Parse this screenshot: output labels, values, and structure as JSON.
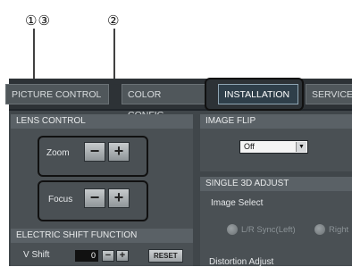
{
  "callouts": {
    "left": "①③",
    "right": "②"
  },
  "tabs": [
    "PICTURE CONTROL",
    "COLOR CONFIG",
    "INSTALLATION",
    "SERVICE"
  ],
  "lens_control": {
    "title": "LENS CONTROL",
    "zoom_label": "Zoom",
    "focus_label": "Focus",
    "minus": "−",
    "plus": "+"
  },
  "electric_shift": {
    "title": "ELECTRIC SHIFT FUNCTION",
    "vshift_label": "V Shift",
    "vshift_value": "0",
    "minus": "−",
    "plus": "+",
    "reset": "RESET"
  },
  "image_flip": {
    "title": "IMAGE FLIP",
    "value": "Off",
    "arrow": "▼"
  },
  "single3d": {
    "title": "SINGLE 3D ADJUST",
    "image_select_label": "Image Select",
    "option_left": "L/R Sync(Left)",
    "option_right": "Right",
    "distortion_label": "Distortion Adjust"
  }
}
